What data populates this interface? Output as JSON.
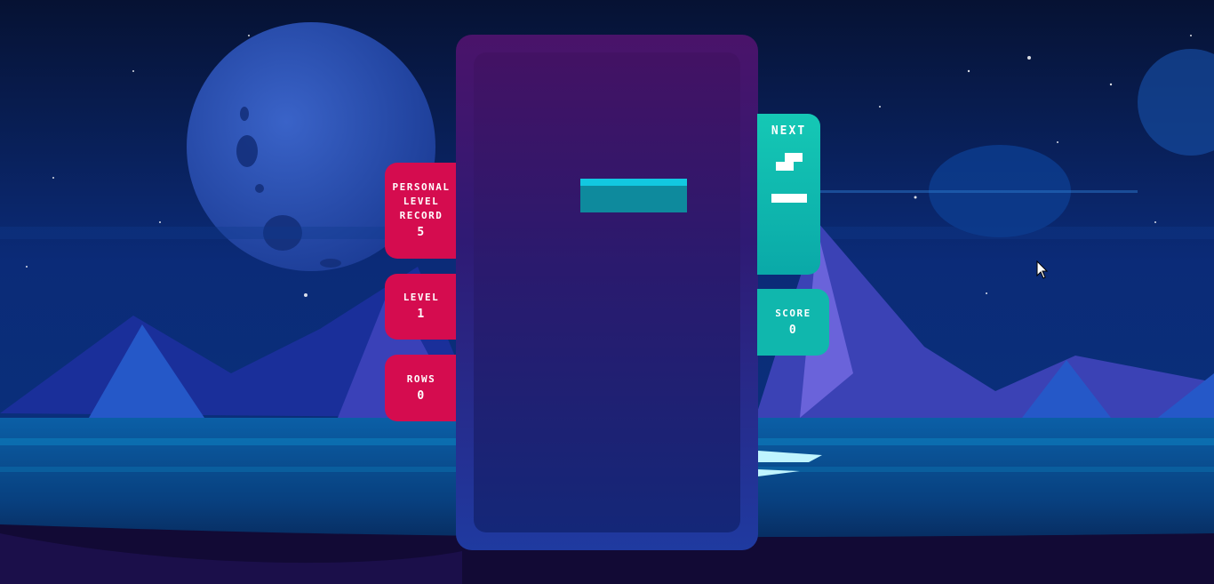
{
  "game": {
    "personal_record": {
      "label_line1": "PERSONAL",
      "label_line2": "LEVEL",
      "label_line3": "RECORD",
      "value": "5"
    },
    "level": {
      "label": "LEVEL",
      "value": "1"
    },
    "rows": {
      "label": "ROWS",
      "value": "0"
    },
    "next": {
      "label": "NEXT"
    },
    "score": {
      "label": "SCORE",
      "value": "0"
    }
  },
  "colors": {
    "left_panel": "#d50c4f",
    "right_panel": "#10b7ad",
    "falling_piece": "#0e8a9d",
    "falling_piece_highlight": "#12c8e0",
    "next_piece": "#ffffff"
  },
  "icons": {
    "falling_piece": "i-tetromino-horizontal",
    "next_piece_1": "s-tetromino",
    "next_piece_2": "i-tetromino-horizontal",
    "cursor": "mouse-pointer-icon"
  }
}
